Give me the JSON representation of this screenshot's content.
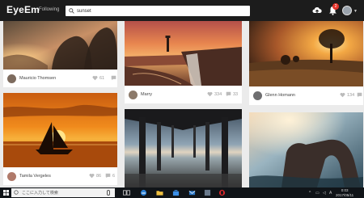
{
  "app": {
    "logo": "EyeEm",
    "nav_following": "Following"
  },
  "search": {
    "value": "sunset"
  },
  "header": {
    "notification_count": "2"
  },
  "photos": [
    {
      "user": "Mauricio Thomsen",
      "likes": "61"
    },
    {
      "user": "Marry",
      "likes": "334",
      "comments": "33"
    },
    {
      "user": "Glenn Homann",
      "likes": "134"
    },
    {
      "user": "Tamila Vergeles",
      "likes": "86",
      "comments": "6"
    },
    {
      "user": "",
      "likes": ""
    },
    {
      "user": "",
      "likes": ""
    }
  ],
  "taskbar": {
    "search_placeholder": "ここに入力して検索",
    "time": "0:03",
    "date": "2017/05/11"
  },
  "colors": {
    "topbar": "#1c1c1c",
    "badge": "#e4342c",
    "taskbar": "#101418"
  }
}
